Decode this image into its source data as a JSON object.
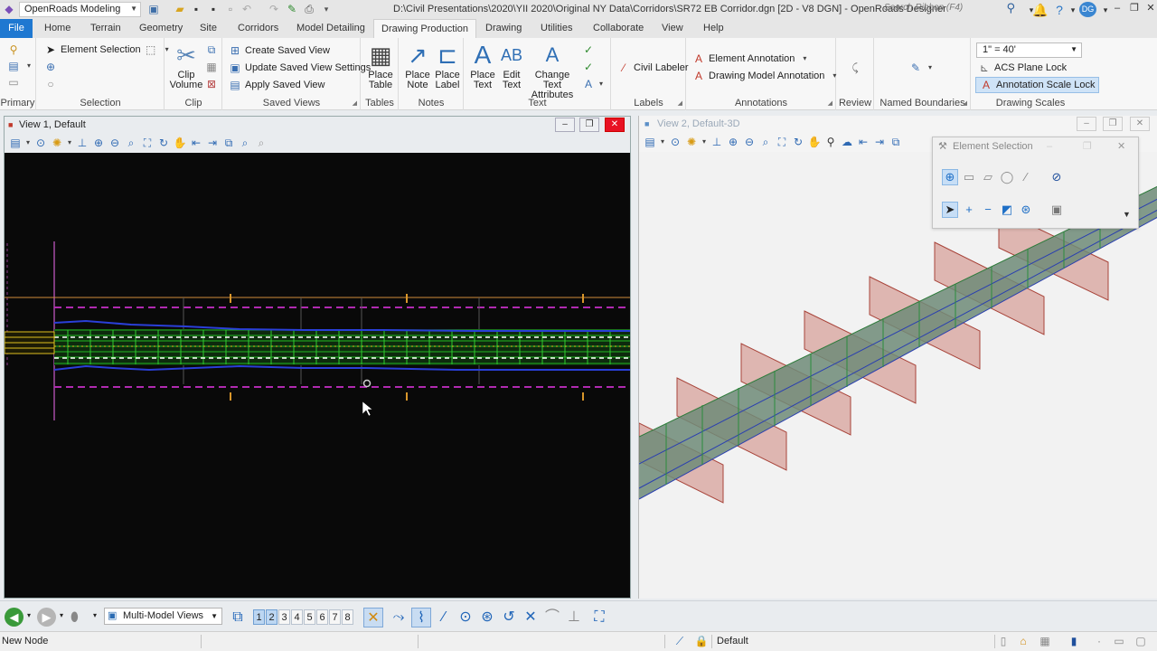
{
  "titlebar": {
    "workflow": "OpenRoads Modeling",
    "title": "D:\\Civil Presentations\\2020\\YII 2020\\Original NY Data\\Corridors\\SR72 EB Corridor.dgn [2D - V8 DGN] - OpenRoads Designer",
    "search_placeholder": "Search Ribbon (F4)",
    "user_initials": "DG"
  },
  "tabs": [
    "File",
    "Home",
    "Terrain",
    "Geometry",
    "Site",
    "Corridors",
    "Model Detailing",
    "Drawing Production",
    "Drawing",
    "Utilities",
    "Collaborate",
    "View",
    "Help"
  ],
  "active_tab": "Drawing Production",
  "ribbon": {
    "primary": {
      "label": "Primary"
    },
    "selection": {
      "label": "Selection",
      "element_selection": "Element Selection"
    },
    "clip": {
      "label": "Clip",
      "clip_volume_line1": "Clip",
      "clip_volume_line2": "Volume"
    },
    "saved_views": {
      "label": "Saved Views",
      "create": "Create Saved View",
      "update": "Update Saved View Settings",
      "apply": "Apply Saved View"
    },
    "tables": {
      "label": "Tables",
      "place_table_line1": "Place",
      "place_table_line2": "Table"
    },
    "notes": {
      "label": "Notes",
      "place_note_line1": "Place",
      "place_note_line2": "Note",
      "place_label_line1": "Place",
      "place_label_line2": "Label"
    },
    "text": {
      "label": "Text",
      "place_text_line1": "Place",
      "place_text_line2": "Text",
      "edit_text_line1": "Edit",
      "edit_text_line2": "Text",
      "change_attr_line1": "Change Text",
      "change_attr_line2": "Attributes"
    },
    "labels": {
      "label": "Labels",
      "civil_labeler": "Civil Labeler"
    },
    "annotations": {
      "label": "Annotations",
      "element_annotation": "Element Annotation",
      "drawing_model_annotation": "Drawing Model Annotation"
    },
    "review": {
      "label": "Review"
    },
    "named_boundaries": {
      "label": "Named Boundaries"
    },
    "drawing_scales": {
      "label": "Drawing Scales",
      "scale_value": "1\" = 40'",
      "acs_plane_lock": "ACS Plane Lock",
      "annotation_scale_lock": "Annotation Scale Lock"
    }
  },
  "view1": {
    "title": "View 1, Default"
  },
  "view2": {
    "title": "View 2, Default-3D"
  },
  "element_selection_dialog": {
    "title": "Element Selection"
  },
  "bottom": {
    "multi_model_views": "Multi-Model Views",
    "view_numbers": [
      "1",
      "2",
      "3",
      "4",
      "5",
      "6",
      "7",
      "8"
    ],
    "active_views": [
      "1",
      "2"
    ]
  },
  "status": {
    "prompt": "New Node",
    "level": "Default"
  },
  "colors": {
    "accent": "#1f78d1",
    "close_red": "#e81123",
    "view1_bg": "#090909"
  }
}
